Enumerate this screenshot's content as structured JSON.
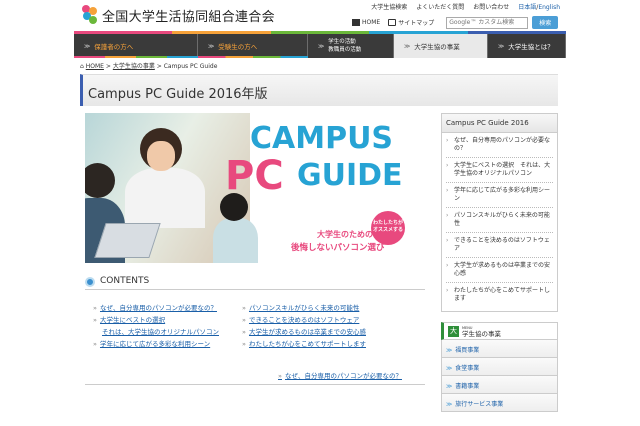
{
  "header": {
    "site_title": "全国大学生活協同組合連合会",
    "top_links": [
      "大学生協検索",
      "よくいただく質問",
      "お問い合わせ"
    ],
    "lang_ja": "日本語",
    "lang_sep": "/",
    "lang_en": "English",
    "home_label": "HOME",
    "sitemap_label": "サイトマップ",
    "search_placeholder": "Google™ カスタム検索",
    "search_button": "検索"
  },
  "colors": {
    "accent_blue": "#3b5eb0",
    "hero_blue": "#27a3d4",
    "hero_pink": "#e8497e",
    "nav_dark": "#3a3a3a",
    "green": "#2f8f3a"
  },
  "nav": [
    {
      "label": "保護者の方へ",
      "style": "orange"
    },
    {
      "label": "受験生の方へ",
      "style": "orange"
    },
    {
      "line1": "学生の活動",
      "line2": "教職員の活動"
    },
    {
      "label": "大学生協の事業",
      "style": "active"
    },
    {
      "label": "大学生協とは？"
    }
  ],
  "breadcrumb": {
    "home": "HOME",
    "sep": ">",
    "parent": "大学生協の事業",
    "current": "Campus PC Guide"
  },
  "page_title": "Campus PC Guide 2016年版",
  "hero": {
    "word1": "CAMPUS",
    "word_pc": "PC",
    "word2": "GUIDE",
    "badge_line1": "わたしたちが",
    "badge_line2": "オススメする",
    "sub1": "大学生のための",
    "sub2": "後悔しないパソコン選び"
  },
  "contents": {
    "heading": "CONTENTS",
    "left": [
      {
        "text": "なぜ、自分専用のパソコンが必要なの？"
      },
      {
        "text": "大学生にベストの選択",
        "cont": "それは、大学生協のオリジナルパソコン"
      },
      {
        "text": "学年に応じて広がる多彩な利用シーン"
      }
    ],
    "right": [
      {
        "text": "パソコンスキルがひらく未来の可能性"
      },
      {
        "text": "できることを決めるのはソフトウェア"
      },
      {
        "text": "大学生が求めるものは卒業までの安心感"
      },
      {
        "text": "わたしたちが心をこめてサポートします"
      }
    ],
    "next": "なぜ、自分専用のパソコンが必要なの？"
  },
  "sidebar": {
    "heading": "Campus PC Guide 2016",
    "items": [
      "なぜ、自分専用のパソコンが必要なの？",
      "大学生にベストの選択　それは、大学生協のオリジナルパソコン",
      "学年に応じて広がる多彩な利用シーン",
      "パソコンスキルがひらく未来の可能性",
      "できることを決めるのはソフトウェア",
      "大学生が求めるものは卒業までの安心感",
      "わたしたちが心をこめてサポートします"
    ],
    "biz_kanji": "大",
    "biz_small": "MENU",
    "biz_heading": "学生協の事業",
    "biz_items": [
      "福買事業",
      "食堂事業",
      "書籍事業",
      "旅行サービス事業"
    ]
  }
}
